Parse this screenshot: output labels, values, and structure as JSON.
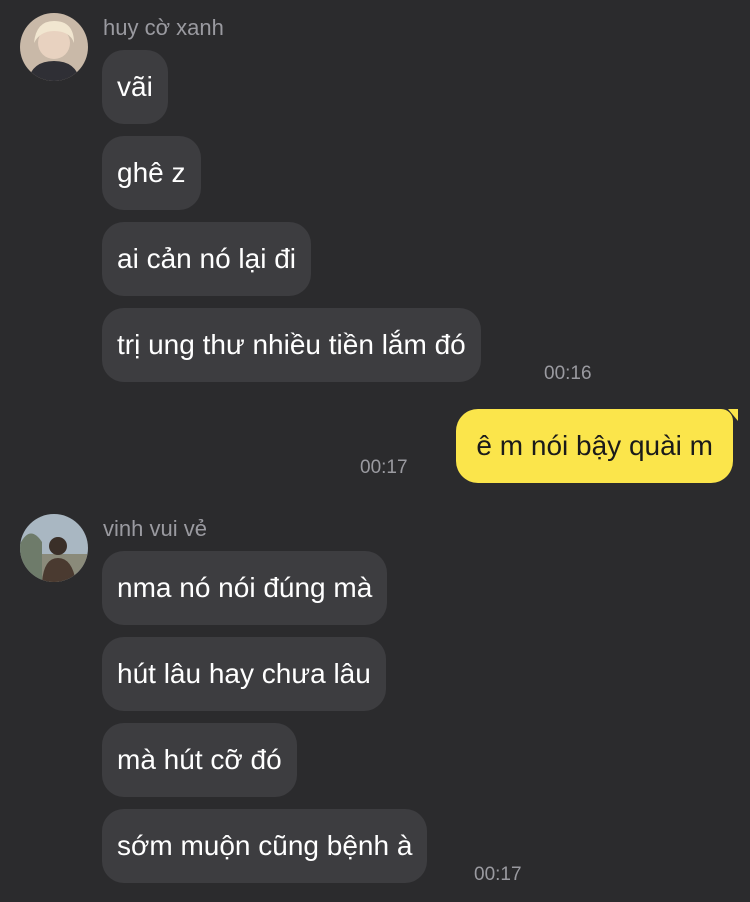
{
  "conversation": {
    "group1": {
      "sender": "huy cờ xanh",
      "avatar_icon": "user-avatar-blond-hair",
      "messages": [
        "vãi",
        "ghê z",
        "ai cản nó lại đi",
        "trị ung thư nhiều tiền lắm đó"
      ],
      "time": "00:16"
    },
    "mine": {
      "text": "ê m nói bậy quài m",
      "time": "00:17",
      "bubble_color": "#fbe54b"
    },
    "group2": {
      "sender": "vinh vui vẻ",
      "avatar_icon": "user-avatar-outdoor-photo",
      "messages": [
        "nma nó nói đúng mà",
        "hút lâu hay chưa lâu",
        "mà hút cỡ đó",
        "sớm muộn cũng bệnh à"
      ],
      "time": "00:17"
    }
  },
  "theme": {
    "background": "#2b2b2d",
    "incoming_bubble": "#3d3d40",
    "outgoing_bubble": "#fbe54b"
  }
}
